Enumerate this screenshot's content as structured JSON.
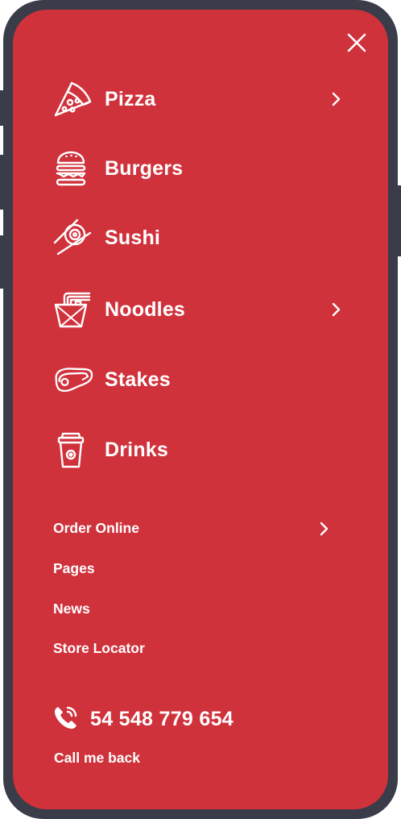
{
  "menu": {
    "close_icon": "close-icon",
    "categories": [
      {
        "label": "Pizza",
        "icon": "pizza-icon",
        "has_submenu": true
      },
      {
        "label": "Burgers",
        "icon": "burger-icon",
        "has_submenu": false
      },
      {
        "label": "Sushi",
        "icon": "sushi-icon",
        "has_submenu": false
      },
      {
        "label": "Noodles",
        "icon": "noodles-icon",
        "has_submenu": true
      },
      {
        "label": "Stakes",
        "icon": "steak-icon",
        "has_submenu": false
      },
      {
        "label": "Drinks",
        "icon": "drink-cup-icon",
        "has_submenu": false
      }
    ],
    "links": [
      {
        "label": "Order Online",
        "has_submenu": true
      },
      {
        "label": "Pages",
        "has_submenu": false
      },
      {
        "label": "News",
        "has_submenu": false
      },
      {
        "label": "Store Locator",
        "has_submenu": false
      }
    ],
    "contact": {
      "phone_icon": "phone-icon",
      "phone_number": "54 548 779 654",
      "callback_label": "Call me back"
    }
  },
  "colors": {
    "screen_background": "#d0323c",
    "frame": "#3a3c49",
    "text": "#ffffff"
  }
}
